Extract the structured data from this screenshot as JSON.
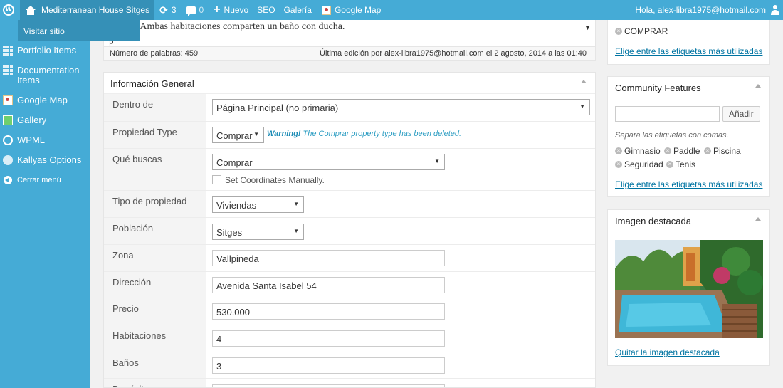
{
  "admin_bar": {
    "site_name": "Mediterranean House Sitges",
    "updates_count": "3",
    "comments_count": "0",
    "new_label": "Nuevo",
    "seo_label": "SEO",
    "gallery_label": "Galería",
    "google_map_label": "Google Map",
    "greeting": "Hola, alex-libra1975@hotmail.com"
  },
  "dropdown": {
    "visit_site": "Visitar sitio"
  },
  "sidebar": {
    "items": [
      {
        "label": "Portfolio Items",
        "icon": "grid-icon"
      },
      {
        "label": "Documentation Items",
        "icon": "grid-icon"
      },
      {
        "label": "Google Map",
        "icon": "map-icon"
      },
      {
        "label": "Gallery",
        "icon": "gallery-icon"
      },
      {
        "label": "WPML",
        "icon": "wpml-icon"
      },
      {
        "label": "Kallyas Options",
        "icon": "options-icon"
      }
    ],
    "collapse_label": "Cerrar menú"
  },
  "editor": {
    "text_fragment": "ble. Ambas habitaciones comparten un baño con ducha.",
    "p_tag": "p",
    "word_count": "Número de palabras: 459",
    "last_edit": "Última edición por alex-libra1975@hotmail.com el 2 agosto, 2014 a las 01:40"
  },
  "info_general": {
    "title": "Información General",
    "fields": {
      "dentro_de": {
        "label": "Dentro de",
        "value": "Página Principal (no primaria)"
      },
      "propiedad_type": {
        "label": "Propiedad Type",
        "value": "Comprar",
        "warning_bold": "Warning!",
        "warning_text": " The Comprar property type has been deleted."
      },
      "que_buscas": {
        "label": "Qué buscas",
        "value": "Comprar",
        "checkbox_label": "Set Coordinates Manually."
      },
      "tipo_propiedad": {
        "label": "Tipo de propiedad",
        "value": "Viviendas"
      },
      "poblacion": {
        "label": "Población",
        "value": "Sitges"
      },
      "zona": {
        "label": "Zona",
        "value": "Vallpineda"
      },
      "direccion": {
        "label": "Dirección",
        "value": "Avenida Santa Isabel 54"
      },
      "precio": {
        "label": "Precio",
        "value": "530.000"
      },
      "habitaciones": {
        "label": "Habitaciones",
        "value": "4"
      },
      "banos": {
        "label": "Baños",
        "value": "3"
      },
      "deposito": {
        "label": "Depósito",
        "value": ""
      }
    }
  },
  "tags_box_top": {
    "tag": "COMPRAR",
    "choose_link": "Elige entre las etiquetas más utilizadas"
  },
  "community_features": {
    "title": "Community Features",
    "input_value": "",
    "add_button": "Añadir",
    "hint": "Separa las etiquetas con comas.",
    "tags": [
      "Gimnasio",
      "Paddle",
      "Piscina",
      "Seguridad",
      "Tenis"
    ],
    "choose_link": "Elige entre las etiquetas más utilizadas"
  },
  "featured_image": {
    "title": "Imagen destacada",
    "remove_link": "Quitar la imagen destacada"
  },
  "colors": {
    "admin_blue": "#45abd6",
    "dropdown_blue": "#3590b7",
    "link_blue": "#0074a2"
  }
}
